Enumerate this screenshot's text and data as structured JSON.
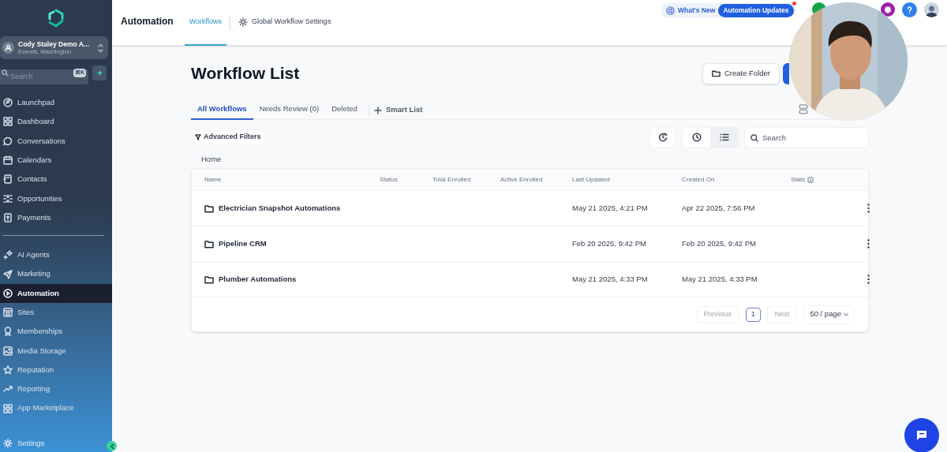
{
  "sidebar": {
    "account": {
      "name": "Cody Staley Demo A...",
      "location": "Everett, Washington"
    },
    "search": {
      "placeholder": "Search",
      "shortcut": "⌘K"
    },
    "items": [
      {
        "label": "Launchpad",
        "selected": false
      },
      {
        "label": "Dashboard",
        "selected": false
      },
      {
        "label": "Conversations",
        "selected": false
      },
      {
        "label": "Calendars",
        "selected": false
      },
      {
        "label": "Contacts",
        "selected": false
      },
      {
        "label": "Opportunities",
        "selected": false
      },
      {
        "label": "Payments",
        "selected": false
      }
    ],
    "items_2": [
      {
        "label": "AI Agents",
        "selected": false
      },
      {
        "label": "Marketing",
        "selected": false
      },
      {
        "label": "Automation",
        "selected": true
      },
      {
        "label": "Sites",
        "selected": false
      },
      {
        "label": "Memberships",
        "selected": false
      },
      {
        "label": "Media Storage",
        "selected": false
      },
      {
        "label": "Reputation",
        "selected": false
      },
      {
        "label": "Reporting",
        "selected": false
      },
      {
        "label": "App Marketplace",
        "selected": false
      }
    ],
    "settings": "Settings"
  },
  "header": {
    "title": "Automation",
    "tabs": [
      {
        "label": "Workflows",
        "selected": true
      },
      {
        "label": "Global Workflow Settings",
        "selected": false
      }
    ],
    "whats_new": "What's New",
    "updates_badge": "Automation Updates"
  },
  "page": {
    "title": "Workflow List",
    "create_folder": "Create Folder",
    "tabs": [
      {
        "label": "All Workflows",
        "selected": true
      },
      {
        "label": "Needs Review (0)",
        "selected": false
      },
      {
        "label": "Deleted",
        "selected": false
      }
    ],
    "smart_list": "Smart List",
    "advanced_filters": "Advanced Filters",
    "view_modes": [
      {
        "kind": "clock",
        "selected": false
      },
      {
        "kind": "list",
        "selected": true
      }
    ],
    "search": {
      "placeholder": "Search"
    },
    "breadcrumb": "Home"
  },
  "table": {
    "columns": [
      "Name",
      "Status",
      "Total Enrolled",
      "Active Enrolled",
      "Last Updated",
      "Created On",
      "Stats"
    ],
    "rows": [
      {
        "name": "Electrician Snapshot Automations",
        "last_updated": "May 21 2025, 4:21 PM",
        "created_on": "Apr 22 2025, 7:56 PM"
      },
      {
        "name": "Pipeline CRM",
        "last_updated": "Feb 20 2025, 9:42 PM",
        "created_on": "Feb 20 2025, 9:42 PM"
      },
      {
        "name": "Plumber Automations",
        "last_updated": "May 21 2025, 4:33 PM",
        "created_on": "May 21 2025, 4:33 PM"
      }
    ]
  },
  "pagination": {
    "previous": "Previous",
    "page": "1",
    "next": "Next",
    "page_size": "50 / page"
  }
}
